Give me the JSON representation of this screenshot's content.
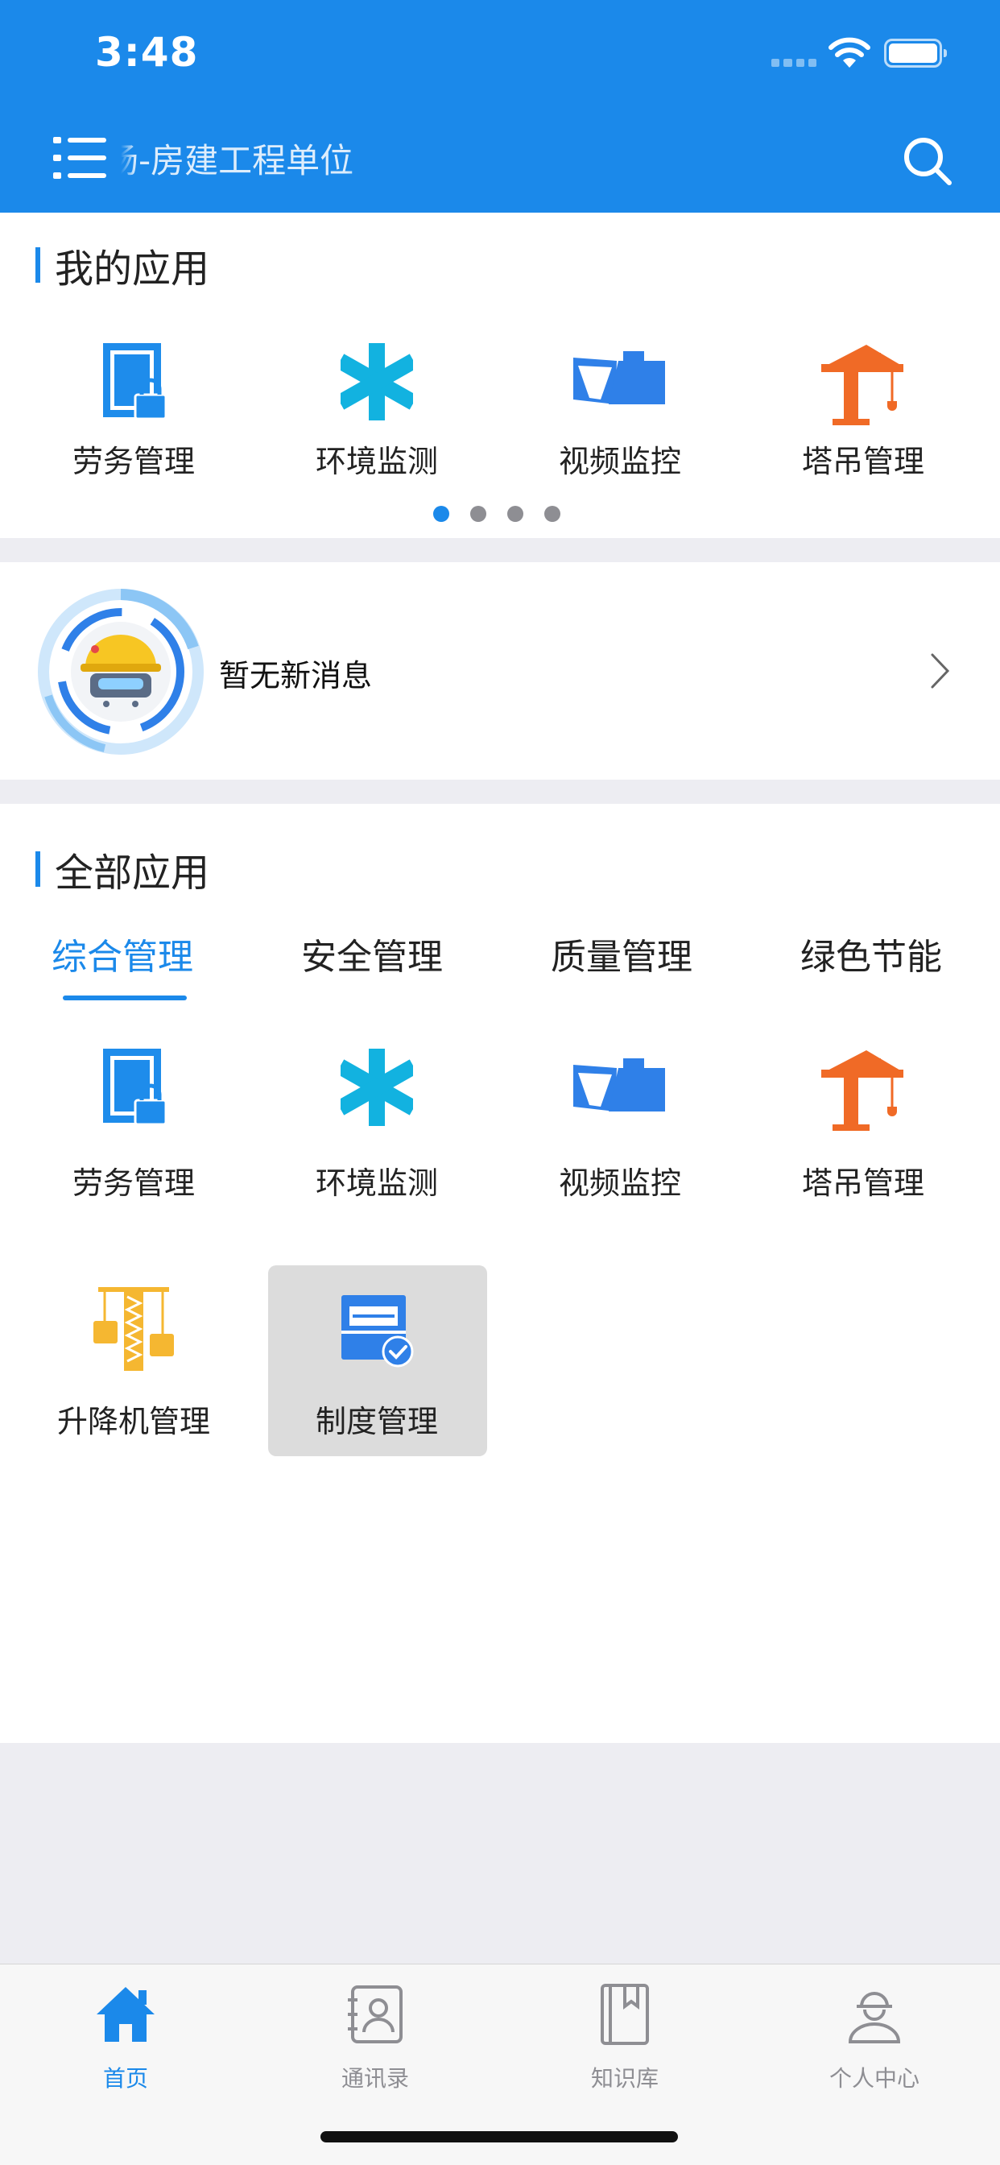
{
  "status": {
    "time": "3:48"
  },
  "header": {
    "title": "场-房建工程单位",
    "menu_icon": "list-menu-icon",
    "search_icon": "search-icon"
  },
  "my_apps": {
    "title": "我的应用",
    "items": [
      {
        "label": "劳务管理",
        "icon": "labor-door-lock-icon"
      },
      {
        "label": "环境监测",
        "icon": "asterisk-icon"
      },
      {
        "label": "视频监控",
        "icon": "video-camera-icon"
      },
      {
        "label": "塔吊管理",
        "icon": "tower-crane-icon"
      }
    ],
    "page_count": 4,
    "current_page": 1
  },
  "messages": {
    "text": "暂无新消息",
    "avatar_icon": "robot-helmet-icon"
  },
  "all_apps": {
    "title": "全部应用",
    "tabs": [
      {
        "label": "综合管理",
        "active": true
      },
      {
        "label": "安全管理",
        "active": false
      },
      {
        "label": "质量管理",
        "active": false
      },
      {
        "label": "绿色节能",
        "active": false
      }
    ],
    "items": [
      {
        "label": "劳务管理",
        "icon": "labor-door-lock-icon"
      },
      {
        "label": "环境监测",
        "icon": "asterisk-icon"
      },
      {
        "label": "视频监控",
        "icon": "video-camera-icon"
      },
      {
        "label": "塔吊管理",
        "icon": "tower-crane-icon"
      },
      {
        "label": "升降机管理",
        "icon": "elevator-icon"
      },
      {
        "label": "制度管理",
        "icon": "policy-folder-icon",
        "selected": true
      }
    ]
  },
  "tabbar": {
    "items": [
      {
        "label": "首页",
        "icon": "home-icon",
        "active": true
      },
      {
        "label": "通讯录",
        "icon": "contacts-icon",
        "active": false
      },
      {
        "label": "知识库",
        "icon": "book-icon",
        "active": false
      },
      {
        "label": "个人中心",
        "icon": "worker-profile-icon",
        "active": false
      }
    ]
  },
  "colors": {
    "primary": "#1B89EA",
    "crane_orange": "#F06A26",
    "elevator_yellow": "#F5B731",
    "teal": "#12B2E0",
    "inactive": "#8E8E93"
  }
}
